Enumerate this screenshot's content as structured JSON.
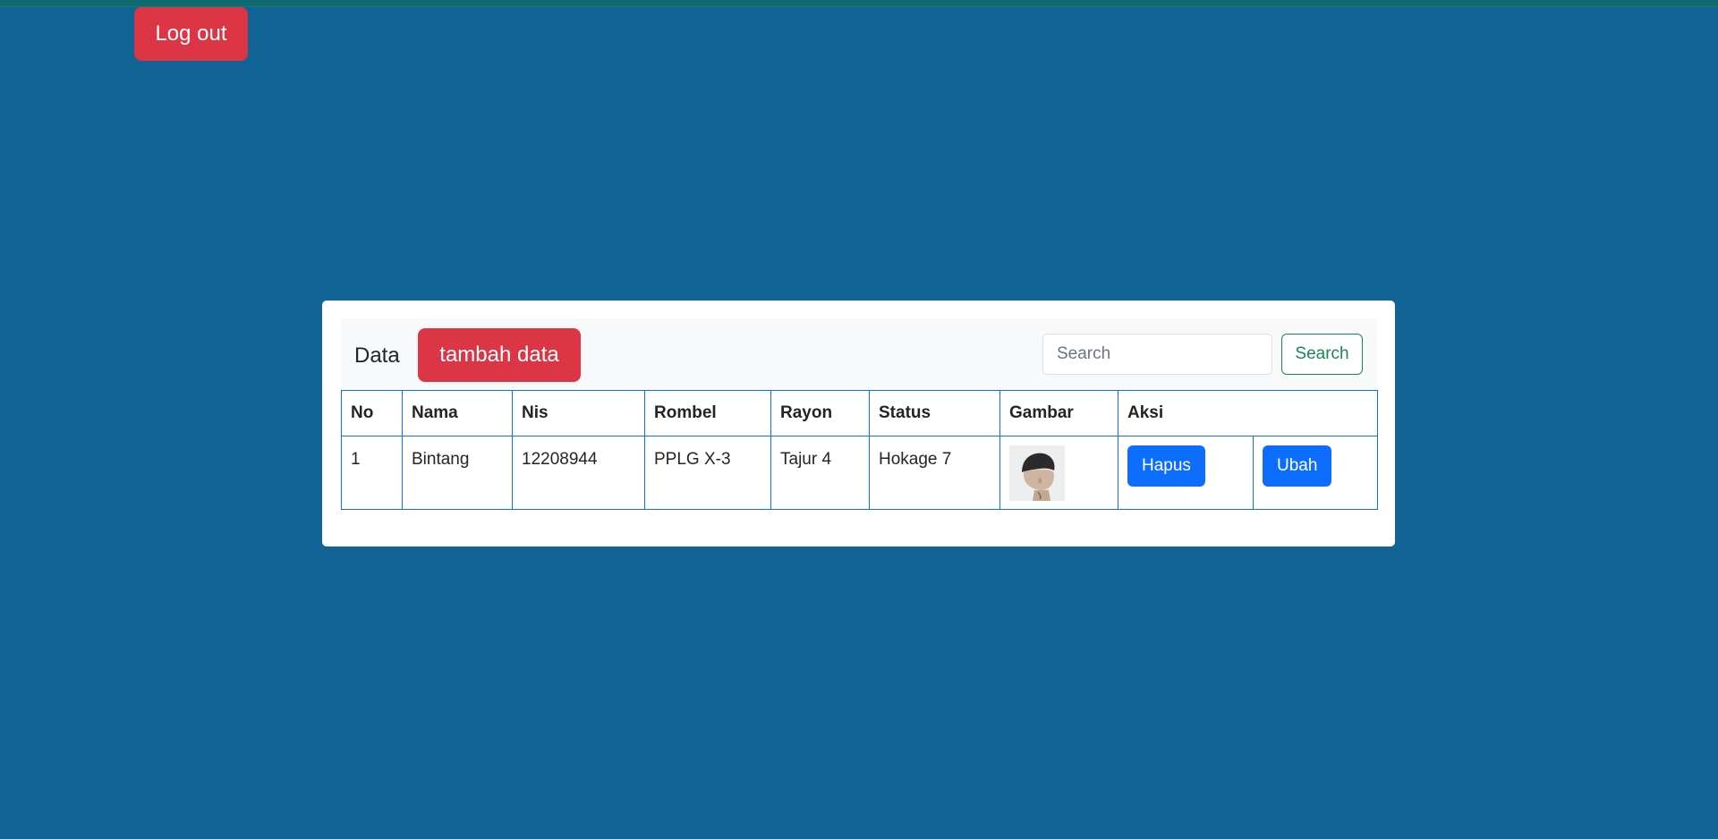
{
  "header": {
    "logout_label": "Log out"
  },
  "toolbar": {
    "brand": "Data",
    "add_label": "tambah data",
    "search_placeholder": "Search",
    "search_button": "Search"
  },
  "table": {
    "columns": [
      "No",
      "Nama",
      "Nis",
      "Rombel",
      "Rayon",
      "Status",
      "Gambar",
      "Aksi"
    ],
    "rows": [
      {
        "no": "1",
        "nama": "Bintang",
        "nis": "12208944",
        "rombel": "PPLG X-3",
        "rayon": "Tajur 4",
        "status": "Hokage 7",
        "gambar": "student-photo",
        "delete_label": "Hapus",
        "edit_label": "Ubah"
      }
    ]
  },
  "colors": {
    "background": "#106394",
    "danger": "#dc3545",
    "primary": "#0d6efd",
    "success": "#198754"
  }
}
